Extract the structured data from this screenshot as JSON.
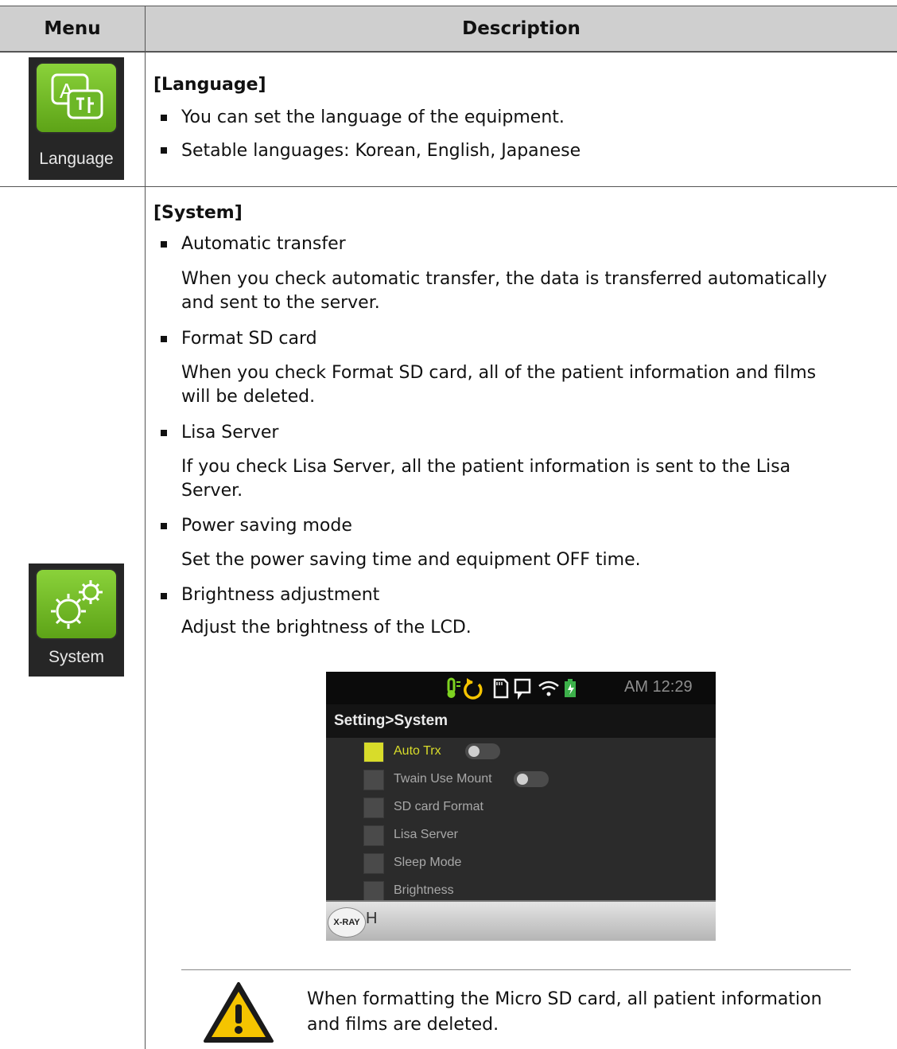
{
  "table": {
    "header": {
      "menu": "Menu",
      "description": "Description"
    },
    "rows": [
      {
        "icon_label": "Language",
        "icon": "language-translate-icon",
        "title": "[Language]",
        "bullets": [
          "You can set the language of the equipment.",
          "Setable languages: Korean, English, Japanese"
        ]
      },
      {
        "icon_label": "System",
        "icon": "gears-icon",
        "title": "[System]",
        "items": [
          {
            "heading": "Automatic transfer",
            "desc": [
              "When you check automatic transfer, the data is transferred automatically",
              "and sent to the server."
            ]
          },
          {
            "heading": "Format SD card",
            "desc": [
              "When you check Format SD card, all of the patient information and films",
              "will be deleted."
            ]
          },
          {
            "heading": "Lisa Server",
            "desc": [
              "If you check Lisa Server, all the patient information is sent to the Lisa",
              "Server."
            ]
          },
          {
            "heading": "Power saving mode",
            "desc": [
              "Set the power saving time and equipment OFF time."
            ]
          },
          {
            "heading": "Brightness adjustment",
            "desc": [
              "Adjust the brightness of the LCD."
            ]
          }
        ]
      }
    ]
  },
  "device": {
    "status_time": "AM 12:29",
    "status_icons": [
      "thermometer-icon",
      "rotate-icon",
      "sd-card-icon",
      "sensor-icon",
      "wifi-icon",
      "battery-charging-icon"
    ],
    "title": "Setting>System",
    "options": [
      {
        "label": "Auto Trx",
        "checked": true,
        "toggle": true
      },
      {
        "label": "Twain Use Mount",
        "checked": false,
        "toggle": true
      },
      {
        "label": "SD card Format",
        "checked": false,
        "toggle": false
      },
      {
        "label": "Lisa Server",
        "checked": false,
        "toggle": false
      },
      {
        "label": "Sleep Mode",
        "checked": false,
        "toggle": false
      },
      {
        "label": "Brightness",
        "checked": false,
        "toggle": false
      }
    ],
    "xray_badge": "X-RAY",
    "bottom_label": "H"
  },
  "warning": {
    "icon": "warning-icon",
    "text": [
      "When formatting the Micro SD card, all patient information",
      "and films are deleted."
    ]
  },
  "colors": {
    "header_bg": "#cfcfcf",
    "icon_green": "#6fba26",
    "check_on": "#d8dc2a",
    "warning_yellow": "#f5c400"
  }
}
